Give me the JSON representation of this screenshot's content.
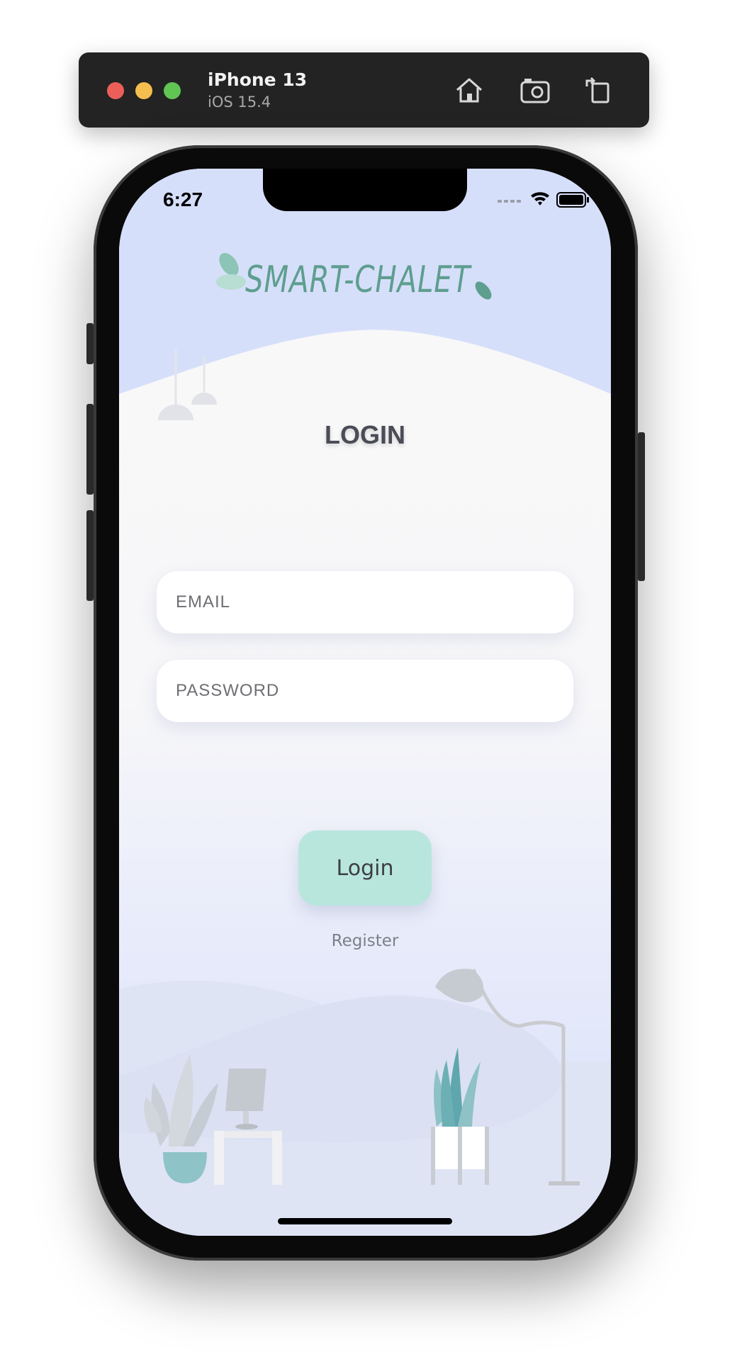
{
  "simulator": {
    "device_name": "iPhone 13",
    "os_version": "iOS 15.4",
    "toolbar_icons": [
      "home-icon",
      "screenshot-icon",
      "rotate-icon"
    ]
  },
  "status_bar": {
    "time": "6:27",
    "icons": [
      "cellular-icon",
      "wifi-icon",
      "battery-icon"
    ]
  },
  "app": {
    "logo_text": "SMART-CHALET",
    "title": "LOGIN",
    "email": {
      "placeholder": "EMAIL",
      "value": ""
    },
    "password": {
      "placeholder": "PASSWORD",
      "value": ""
    },
    "login_button": "Login",
    "register_link": "Register"
  },
  "colors": {
    "accent_teal": "#5e9e8f",
    "button_bg": "#b8e6dd",
    "background_blue": "#d7e0fb"
  }
}
